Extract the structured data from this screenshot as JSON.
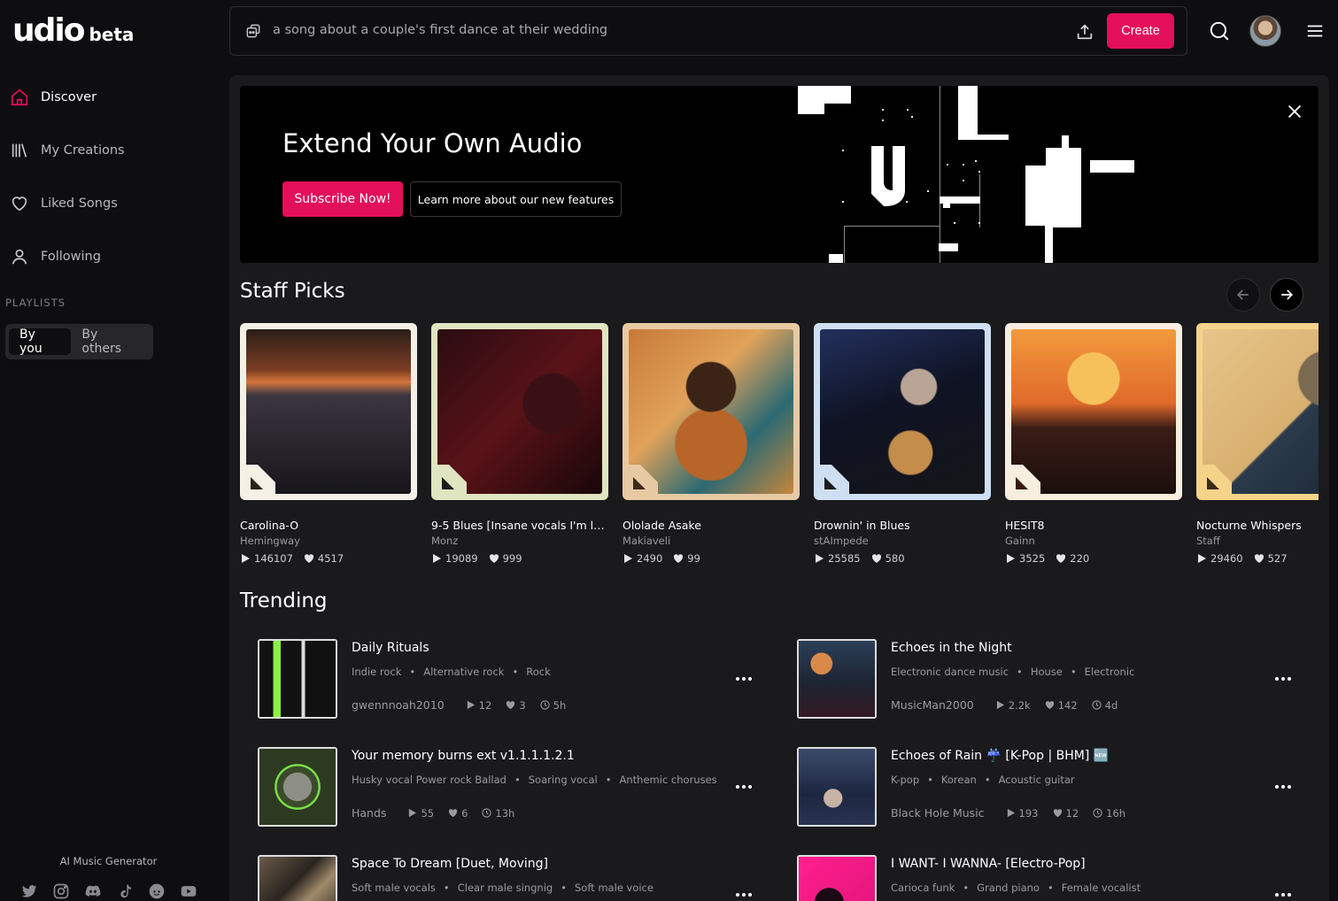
{
  "brand": {
    "name": "udio",
    "tag": "beta"
  },
  "sidebar": {
    "items": [
      {
        "label": "Discover",
        "icon": "home-icon",
        "active": true
      },
      {
        "label": "My Creations",
        "icon": "library-icon"
      },
      {
        "label": "Liked Songs",
        "icon": "heart-icon"
      },
      {
        "label": "Following",
        "icon": "user-icon"
      }
    ],
    "playlists_heading": "PLAYLISTS",
    "playlist_tabs": [
      "By you",
      "By others"
    ],
    "footer_label": "AI Music Generator",
    "socials": [
      "twitter-icon",
      "instagram-icon",
      "discord-icon",
      "tiktok-icon",
      "reddit-icon",
      "youtube-icon"
    ]
  },
  "topbar": {
    "prompt": "a song about a couple's first dance at their wedding",
    "create_label": "Create"
  },
  "banner": {
    "title": "Extend Your Own Audio",
    "primary_label": "Subscribe Now!",
    "secondary_label": "Learn more about our new features"
  },
  "staff_picks": {
    "title": "Staff Picks",
    "cards": [
      {
        "title": "Carolina-O",
        "artist": "Hemingway",
        "plays": "146107",
        "likes": "4517",
        "frame": "#f4f0e6",
        "corner": "#2a2218"
      },
      {
        "title": "9-5 Blues [Insane vocals I'm lit...",
        "artist": "Monz",
        "plays": "19089",
        "likes": "999",
        "frame": "#dfe5c0",
        "corner": "#1b1b1b"
      },
      {
        "title": "Ololade Asake",
        "artist": "Makiaveli",
        "plays": "2490",
        "likes": "99",
        "frame": "#e7c9a3",
        "corner": "#3a2a1a"
      },
      {
        "title": "Drownin' in Blues",
        "artist": "stAImpede",
        "plays": "25585",
        "likes": "580",
        "frame": "#cfdff2",
        "corner": "#1b1b1b"
      },
      {
        "title": "HESIT8",
        "artist": "Gainn",
        "plays": "3525",
        "likes": "220",
        "frame": "#f7eee0",
        "corner": "#3a1a10"
      },
      {
        "title": "Nocturne Whispers",
        "artist": "Staff",
        "plays": "29460",
        "likes": "527",
        "frame": "#f5d38a",
        "corner": "#3a2a1a"
      }
    ]
  },
  "trending": {
    "title": "Trending",
    "rows": [
      {
        "title": "Daily Rituals",
        "tags": [
          "Indie rock",
          "Alternative rock",
          "Rock"
        ],
        "artist": "gwennnoah2010",
        "plays": "12",
        "likes": "3",
        "age": "5h"
      },
      {
        "title": "Echoes in the Night",
        "tags": [
          "Electronic dance music",
          "House",
          "Electronic"
        ],
        "artist": "MusicMan2000",
        "plays": "2.2k",
        "likes": "142",
        "age": "4d"
      },
      {
        "title": "Your memory burns ext v1.1.1.1.2.1",
        "tags": [
          "Husky vocal Power rock Ballad",
          "Soaring vocal",
          "Anthemic choruses"
        ],
        "artist": "Hands",
        "plays": "55",
        "likes": "6",
        "age": "13h"
      },
      {
        "title": "Echoes of Rain ☔️ [K-Pop | BHM] 🆕",
        "tags": [
          "K-pop",
          "Korean",
          "Acoustic guitar"
        ],
        "artist": "Black Hole Music",
        "plays": "193",
        "likes": "12",
        "age": "16h"
      },
      {
        "title": "Space To Dream [Duet, Moving]",
        "tags": [
          "Soft male vocals",
          "Clear male singnig",
          "Soft male voice"
        ],
        "artist": "",
        "plays": "",
        "likes": "",
        "age": ""
      },
      {
        "title": "I WANT- I WANNA- [Electro-Pop]",
        "tags": [
          "Carioca funk",
          "Grand piano",
          "Female vocalist"
        ],
        "artist": "",
        "plays": "",
        "likes": "",
        "age": ""
      }
    ]
  },
  "colors": {
    "accent": "#e30f59",
    "panel": "#1a1a1d",
    "background": "#0e0e10"
  }
}
